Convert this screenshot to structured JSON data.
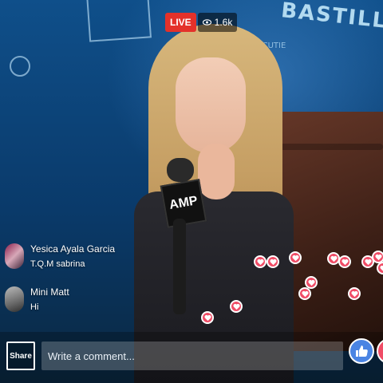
{
  "live_badge": {
    "label": "LIVE",
    "viewers": "1.6k",
    "icon": "eye-icon",
    "color": "#e4312a"
  },
  "background": {
    "wall_text": [
      "BASTILLE",
      "AB FOR CUTIE"
    ],
    "mic_flag_text": "AMP"
  },
  "comments": [
    {
      "name": "Yesica Ayala Garcia",
      "message": "T.Q.M sabrina"
    },
    {
      "name": "Mini Matt",
      "message": "Hi"
    }
  ],
  "bottom_bar": {
    "share_label": "Share",
    "comment_placeholder": "Write a comment...",
    "like_icon": "thumbs-up-icon",
    "love_icon": "heart-icon"
  },
  "colors": {
    "heart": "#f04c66",
    "like": "#4a84e3"
  }
}
